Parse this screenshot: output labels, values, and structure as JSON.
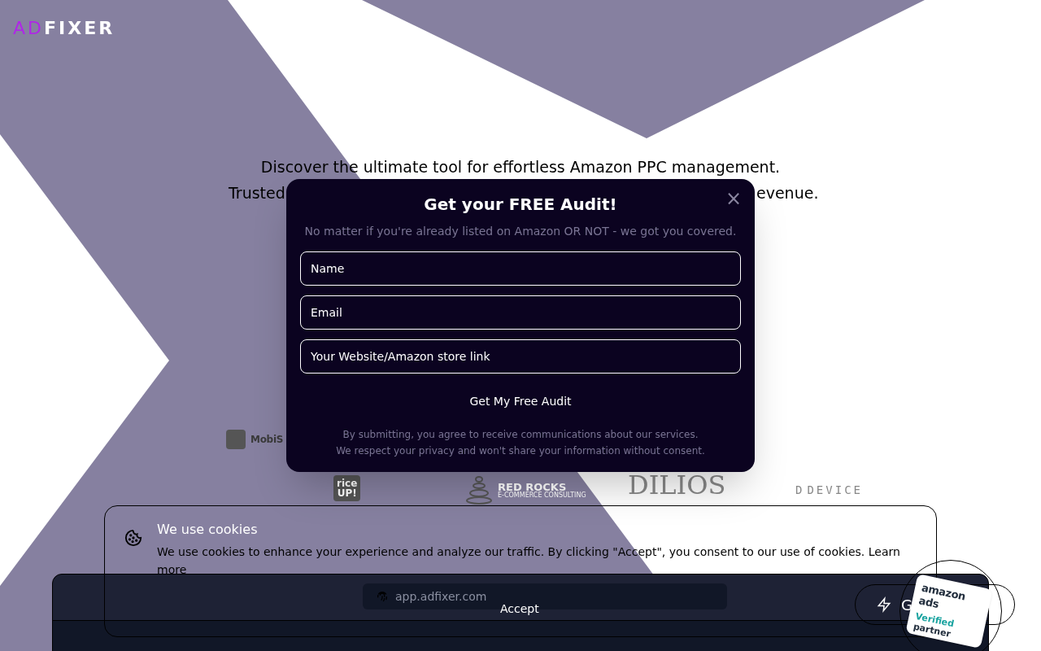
{
  "logo": {
    "left": "AD",
    "right": "FIXER"
  },
  "hero": {
    "line_1": "Discover the ultimate tool for effortless Amazon PPC management.",
    "line_2_start": "Trusted",
    "line_2_end": "evenue."
  },
  "client_logos": [
    {
      "kind": "mobis",
      "text": "MobiS"
    },
    {
      "kind": "riceup",
      "text": "rice",
      "subtext": "UP!"
    },
    {
      "kind": "redrocks",
      "text": "RED ROCKS",
      "subtext": "E-COMMERCE CONSULTING"
    },
    {
      "kind": "dilios",
      "text": "DILIOS"
    },
    {
      "kind": "device",
      "text": "D",
      "subtext": "DEVICE"
    }
  ],
  "audit_modal": {
    "title": "Get your FREE Audit!",
    "close": "×",
    "subtitle": "No matter if you're already listed on Amazon OR NOT - we got you covered.",
    "fields": [
      {
        "placeholder": "Name"
      },
      {
        "placeholder": "Email"
      },
      {
        "placeholder": "Your Website/Amazon store link"
      }
    ],
    "submit": "Get My Free Audit",
    "disclaimer": [
      "By submitting, you agree to receive communications about our services.",
      "We respect your privacy and won't share your information without consent."
    ]
  },
  "app_preview": {
    "url": "app.adfixer.com",
    "button": "G"
  },
  "cookie_banner": {
    "title": "We use cookies",
    "text": "We use cookies to enhance your experience and analyze our traffic. By clicking \"Accept\", you consent to our use of cookies. Learn more",
    "accept": "Accept"
  },
  "partner_badge": {
    "brand": "amazon ads",
    "line_1": "Verified",
    "line_2": "partner"
  }
}
